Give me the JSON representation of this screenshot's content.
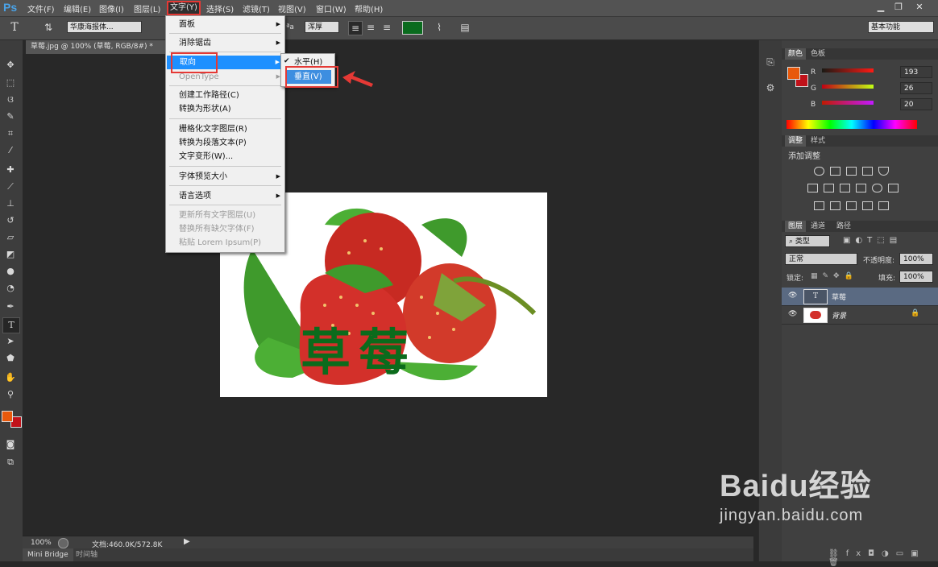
{
  "app": {
    "logo": "Ps"
  },
  "menubar": {
    "items": [
      "文件(F)",
      "编辑(E)",
      "图像(I)",
      "图层(L)",
      "文字(Y)",
      "选择(S)",
      "滤镜(T)",
      "视图(V)",
      "窗口(W)",
      "帮助(H)"
    ],
    "window_buttons": [
      "▁",
      "❐",
      "✕"
    ]
  },
  "optbar": {
    "font_family": "华康海报体...",
    "antialias": "浑厚",
    "text_color": "#0a6b1e",
    "workspace": "基本功能"
  },
  "document": {
    "tab_title": "草莓.jpg @ 100% (草莓, RGB/8#) *",
    "canvas_text": "草莓",
    "canvas_text_color": "#0b6b1c"
  },
  "type_menu": {
    "items": [
      {
        "label": "面板",
        "arrow": true,
        "disabled": false
      },
      {
        "label": "消除锯齿",
        "arrow": true,
        "disabled": false
      },
      {
        "label": "取向",
        "arrow": true,
        "disabled": false
      },
      {
        "label": "OpenType",
        "arrow": true,
        "disabled": true
      },
      {
        "label": "创建工作路径(C)",
        "arrow": false,
        "disabled": false
      },
      {
        "label": "转换为形状(A)",
        "arrow": false,
        "disabled": false
      },
      {
        "label": "栅格化文字图层(R)",
        "arrow": false,
        "disabled": false
      },
      {
        "label": "转换为段落文本(P)",
        "arrow": false,
        "disabled": false
      },
      {
        "label": "文字变形(W)...",
        "arrow": false,
        "disabled": false
      },
      {
        "label": "字体预览大小",
        "arrow": true,
        "disabled": false
      },
      {
        "label": "语言选项",
        "arrow": true,
        "disabled": false
      },
      {
        "label": "更新所有文字图层(U)",
        "arrow": false,
        "disabled": true
      },
      {
        "label": "替换所有缺欠字体(F)",
        "arrow": false,
        "disabled": true
      },
      {
        "label": "粘贴 Lorem Ipsum(P)",
        "arrow": false,
        "disabled": true
      }
    ]
  },
  "orient_submenu": {
    "horizontal": "水平(H)",
    "vertical": "垂直(V)",
    "checkmark": "✔"
  },
  "status": {
    "zoom": "100%",
    "doc_info": "文档:460.0K/572.8K",
    "tabs": [
      "Mini Bridge",
      "时间轴"
    ]
  },
  "color_panel": {
    "tabs": [
      "颜色",
      "色板"
    ],
    "r_label": "R",
    "r_value": "193",
    "g_label": "G",
    "g_value": "26",
    "b_label": "B",
    "b_value": "20",
    "fg_color": "#e8590c",
    "bg_color": "#c1121a"
  },
  "adjust_panel": {
    "tabs": [
      "调整",
      "样式"
    ],
    "title": "添加调整"
  },
  "layers_panel": {
    "tabs": [
      "图层",
      "通道",
      "路径"
    ],
    "filter": "类型",
    "blend_mode": "正常",
    "opacity_label": "不透明度:",
    "opacity_value": "100%",
    "lock_label": "锁定:",
    "fill_label": "填充:",
    "fill_value": "100%",
    "layers": [
      {
        "name": "草莓",
        "kind": "text"
      },
      {
        "name": "背景",
        "kind": "image"
      }
    ]
  },
  "watermark": {
    "brand": "Baidu经验",
    "url": "jingyan.baidu.com"
  }
}
